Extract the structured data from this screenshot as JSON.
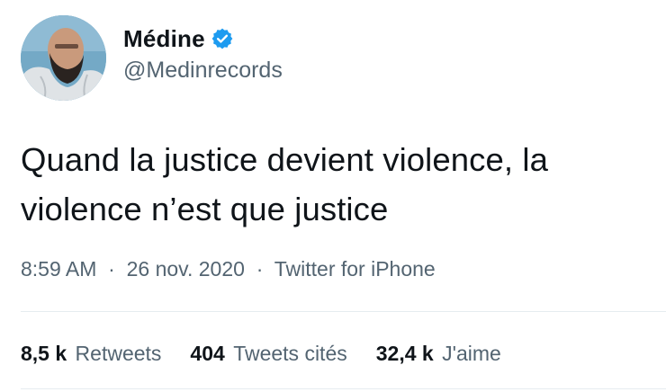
{
  "author": {
    "name": "Médine",
    "handle": "@Medinrecords",
    "verified": true
  },
  "tweet": {
    "text": "Quand la justice devient violence, la violence n’est que justice",
    "time": "8:59 AM",
    "date": "26 nov. 2020",
    "source": "Twitter for iPhone",
    "separator": "·"
  },
  "stats": {
    "retweets_count": "8,5 k",
    "retweets_label": "Retweets",
    "quotes_count": "404",
    "quotes_label": "Tweets cités",
    "likes_count": "32,4 k",
    "likes_label": "J'aime"
  },
  "colors": {
    "verified_badge": "#1d9bf0",
    "secondary_text": "#536471"
  }
}
